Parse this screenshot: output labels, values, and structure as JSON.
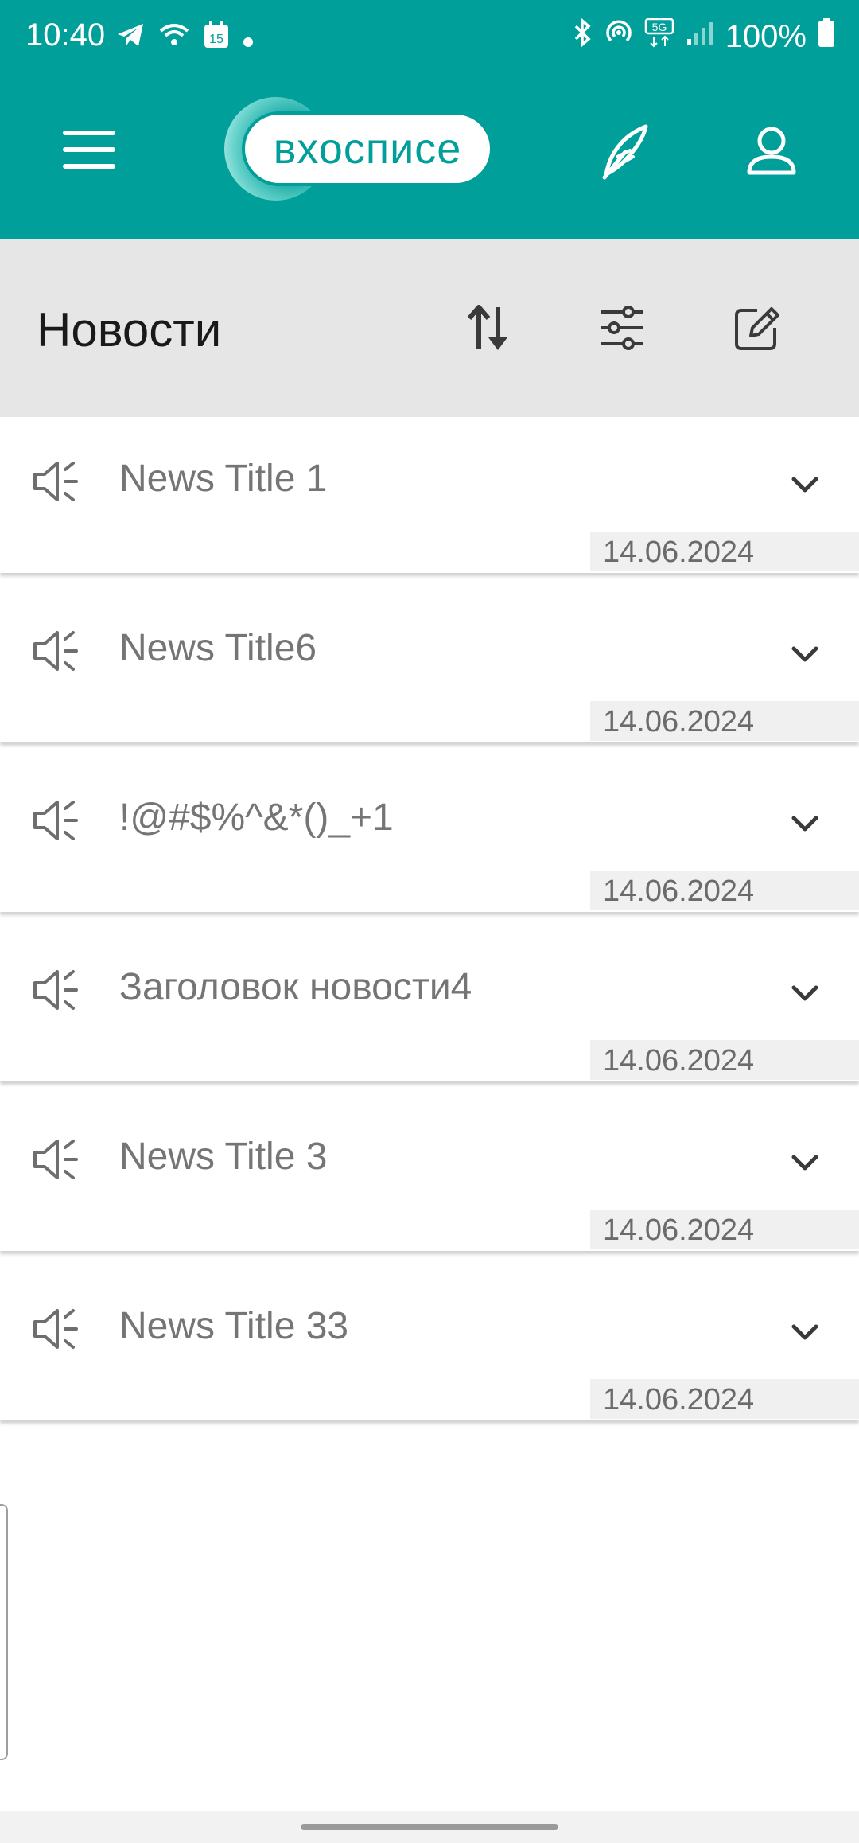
{
  "status_bar": {
    "time": "10:40",
    "calendar_day": "15",
    "battery": "100%",
    "network": "5G"
  },
  "app_bar": {
    "logo_text": "вхосписе",
    "menu_icon": "hamburger-menu-icon",
    "feather_icon": "feather-icon",
    "user_icon": "user-icon",
    "background_color": "#009f9a"
  },
  "section": {
    "title": "Новости",
    "sort_icon": "sort-icon",
    "filter_icon": "filter-icon",
    "edit_icon": "edit-icon"
  },
  "news": [
    {
      "title": "News Title 1",
      "date": "14.06.2024"
    },
    {
      "title": "News Title6",
      "date": "14.06.2024"
    },
    {
      "title": "!@#$%^&*()_+1",
      "date": "14.06.2024"
    },
    {
      "title": "Заголовок новости4",
      "date": "14.06.2024"
    },
    {
      "title": "News Title 3",
      "date": "14.06.2024"
    },
    {
      "title": "News Title 33",
      "date": "14.06.2024"
    }
  ]
}
